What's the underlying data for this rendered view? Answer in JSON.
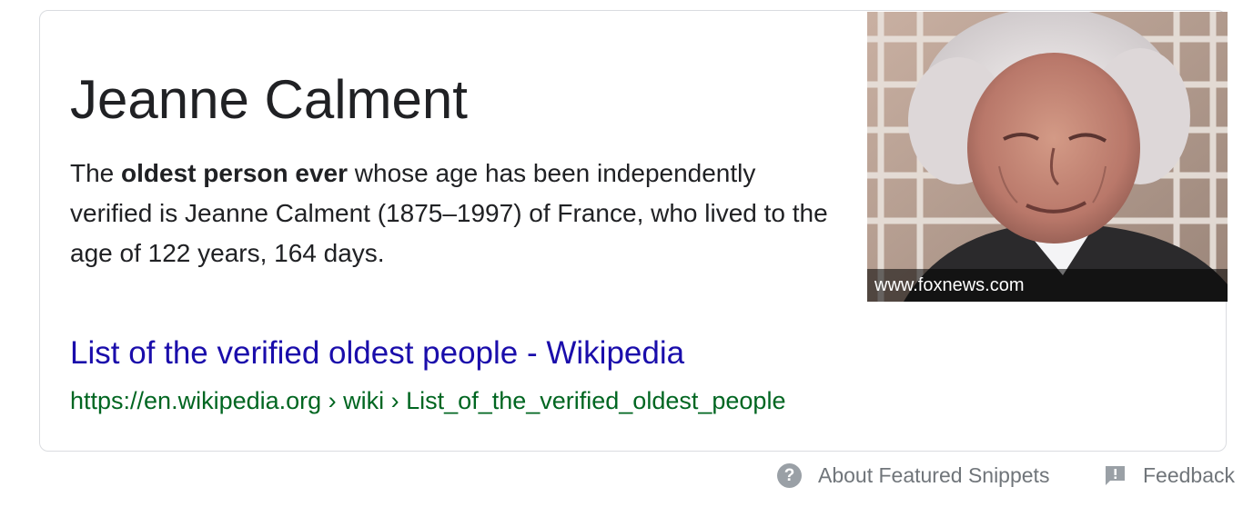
{
  "snippet": {
    "title": "Jeanne Calment",
    "description": {
      "prefix": "The ",
      "bold": "oldest person ever",
      "rest": " whose age has been independently verified is Jeanne Calment (1875–1997) of France, who lived to the age of 122 years, 164 days."
    },
    "image": {
      "source": "www.foxnews.com"
    },
    "link": {
      "title": "List of the verified oldest people - Wikipedia",
      "breadcrumb": "https://en.wikipedia.org › wiki › List_of_the_verified_oldest_people"
    }
  },
  "footer": {
    "about_label": "About Featured Snippets",
    "feedback_label": "Feedback"
  },
  "colors": {
    "link": "#1a0dab",
    "url": "#006621",
    "text": "#202124",
    "muted": "#70757a",
    "border": "#dadce0"
  },
  "icons": {
    "help": "question-circle-icon",
    "feedback": "feedback-flag-icon"
  }
}
